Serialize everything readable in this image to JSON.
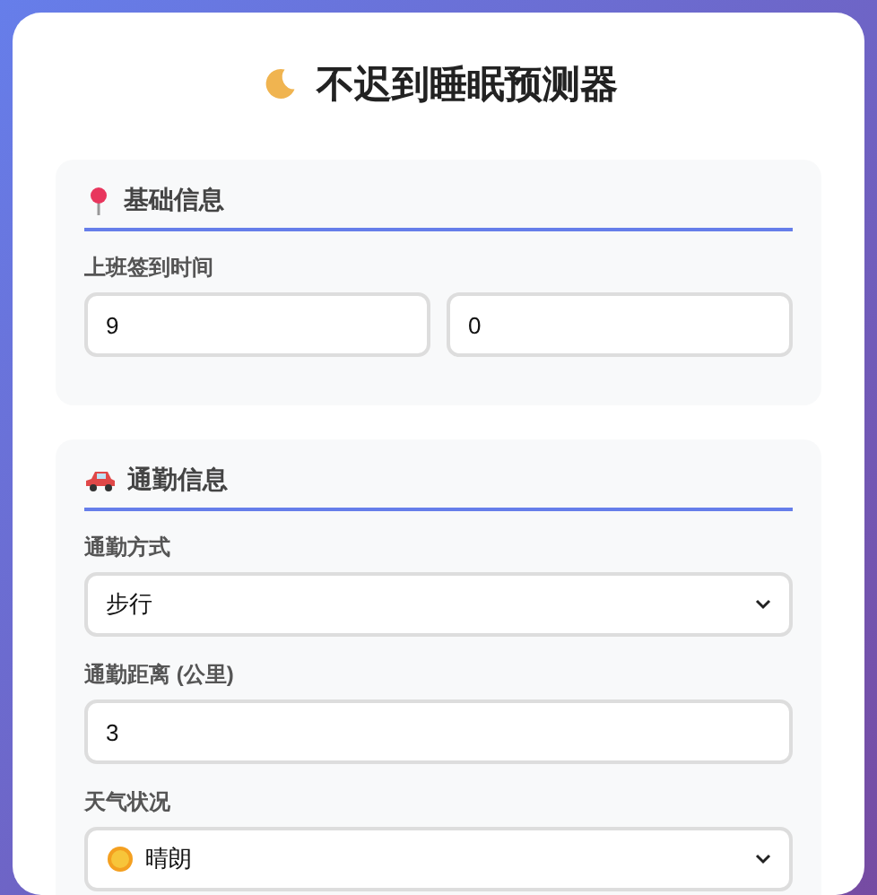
{
  "title": {
    "text": "不迟到睡眠预测器"
  },
  "sections": [
    {
      "heading": "基础信息",
      "fields": [
        {
          "kind": "pair",
          "label": "上班签到时间",
          "values": [
            "9",
            "0"
          ]
        }
      ]
    },
    {
      "heading": "通勤信息",
      "fields": [
        {
          "kind": "select",
          "label": "通勤方式",
          "value": "步行"
        },
        {
          "kind": "input",
          "label": "通勤距离 (公里)",
          "value": "3"
        },
        {
          "kind": "select",
          "label": "天气状况",
          "value": "晴朗"
        }
      ]
    }
  ]
}
